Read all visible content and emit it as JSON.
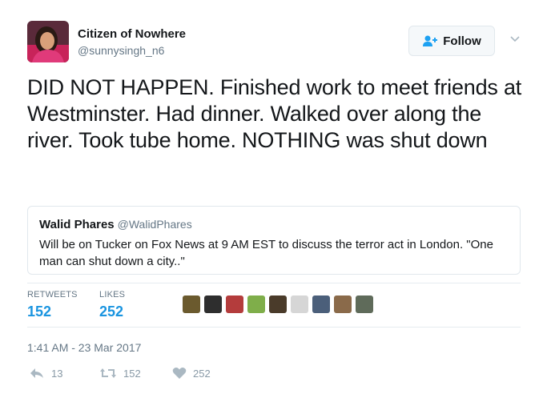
{
  "author": {
    "name": "Citizen of Nowhere",
    "handle": "@sunnysingh_n6",
    "avatar_icon": "profile-photo"
  },
  "follow_button": {
    "label": "Follow",
    "icon": "follow-person-plus-icon"
  },
  "menu": {
    "icon": "chevron-down-icon"
  },
  "tweet": {
    "text": "DID NOT HAPPEN. Finished work to meet friends at Westminster. Had dinner. Walked over along the river. Took tube home. NOTHING was shut down"
  },
  "quoted_tweet": {
    "name": "Walid Phares",
    "handle": "@WalidPhares",
    "text": "Will be on Tucker on Fox News at 9 AM EST to discuss the terror act in London. \"One man can shut down a city..\""
  },
  "stats": {
    "retweets_label": "RETWEETS",
    "retweets_value": "152",
    "likes_label": "LIKES",
    "likes_value": "252"
  },
  "liker_avatars": [
    {
      "name": "liker-avatar-1",
      "color": "#6b5a2e"
    },
    {
      "name": "liker-avatar-2",
      "color": "#2e2e2e"
    },
    {
      "name": "liker-avatar-3",
      "color": "#b43c3c"
    },
    {
      "name": "liker-avatar-4",
      "color": "#7fae4a"
    },
    {
      "name": "liker-avatar-5",
      "color": "#4a3b2a"
    },
    {
      "name": "liker-avatar-6",
      "color": "#d6d6d6"
    },
    {
      "name": "liker-avatar-7",
      "color": "#4b5f7a"
    },
    {
      "name": "liker-avatar-8",
      "color": "#8a6a4a"
    },
    {
      "name": "liker-avatar-9",
      "color": "#5f6b5a"
    }
  ],
  "timestamp": "1:41 AM - 23 Mar 2017",
  "actions": {
    "reply_count": "13",
    "retweet_count": "152",
    "like_count": "252"
  },
  "colors": {
    "accent": "#1b95e0",
    "text": "#14171a",
    "muted": "#657786",
    "border": "#e1e8ed"
  }
}
